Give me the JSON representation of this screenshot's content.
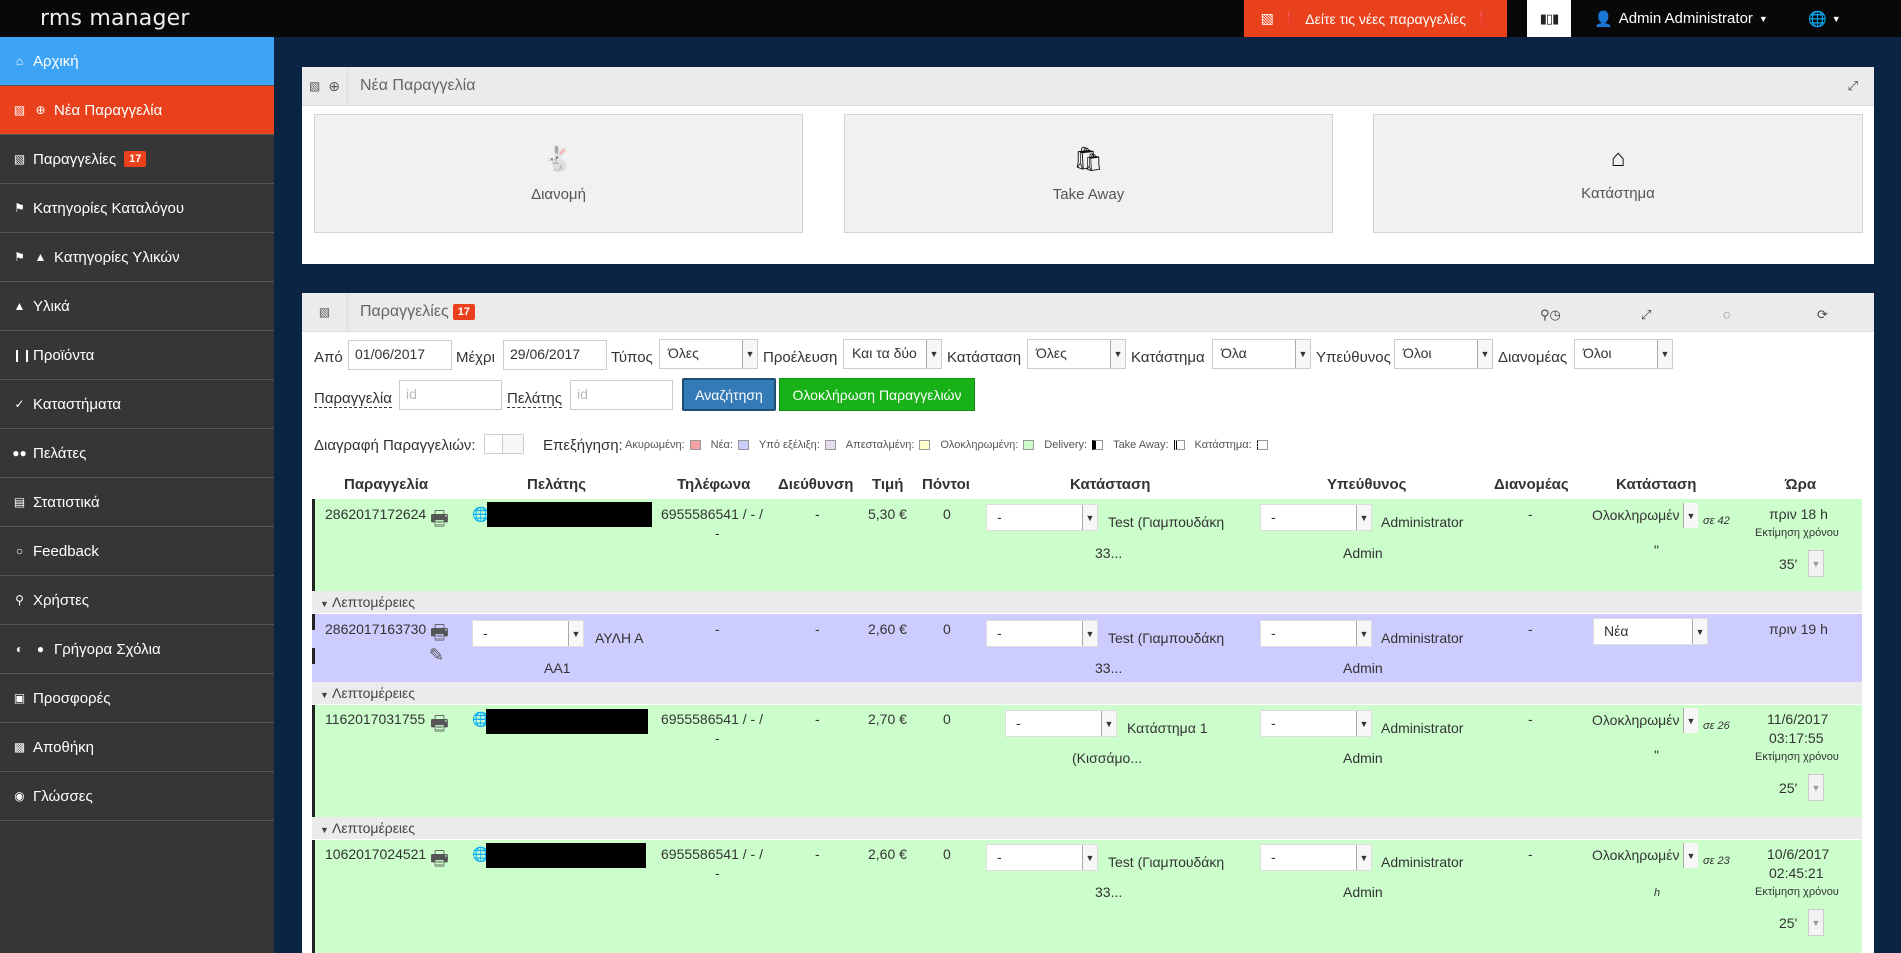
{
  "app": {
    "brand": "rms manager",
    "new_orders_alert": "Δείτε τις νέες παραγγελίες",
    "user": "Admin Administrator"
  },
  "sidebar": {
    "items": [
      {
        "label": "Αρχική",
        "icon": "home-icon"
      },
      {
        "label": "Νέα Παραγγελία",
        "icon": "inbox-plus-icon"
      },
      {
        "label": "Παραγγελίες",
        "icon": "inbox-icon",
        "badge": "17"
      },
      {
        "label": "Κατηγορίες Καταλόγου",
        "icon": "tags-icon"
      },
      {
        "label": "Κατηγορίες Υλικών",
        "icon": "tags-flask-icon"
      },
      {
        "label": "Υλικά",
        "icon": "flask-icon"
      },
      {
        "label": "Προϊόντα",
        "icon": "cutlery-icon"
      },
      {
        "label": "Καταστήματα",
        "icon": "cart-icon"
      },
      {
        "label": "Πελάτες",
        "icon": "users-icon"
      },
      {
        "label": "Στατιστικά",
        "icon": "bar-chart-icon"
      },
      {
        "label": "Feedback",
        "icon": "comment-icon"
      },
      {
        "label": "Χρήστες",
        "icon": "key-icon"
      },
      {
        "label": "Γρήγορα Σχόλια",
        "icon": "dashboard-comment-icon"
      },
      {
        "label": "Προσφορές",
        "icon": "gift-icon"
      },
      {
        "label": "Αποθήκη",
        "icon": "truck-icon"
      },
      {
        "label": "Γλώσσες",
        "icon": "globe-icon"
      }
    ]
  },
  "new_order_panel": {
    "title": "Νέα Παραγγελία",
    "types": [
      {
        "label": "Διανομή",
        "icon": "rabbit-icon"
      },
      {
        "label": "Take Away",
        "icon": "shopping-bag-icon"
      },
      {
        "label": "Κατάστημα",
        "icon": "home-icon"
      }
    ]
  },
  "orders_panel": {
    "title": "Παραγγελίες",
    "badge": "17",
    "filters": {
      "from_label": "Από",
      "from_value": "01/06/2017",
      "to_label": "Μέχρι",
      "to_value": "29/06/2017",
      "type_label": "Τύπος",
      "type_value": "Όλες",
      "origin_label": "Προέλευση",
      "origin_value": "Και τα δύο",
      "status_label": "Κατάσταση",
      "status_value": "Όλες",
      "store_label": "Κατάστημα",
      "store_value": "Όλα",
      "responsible_label": "Υπεύθυνος",
      "responsible_value": "Όλοι",
      "courier_label": "Διανομέας",
      "courier_value": "Όλοι",
      "order_label": "Παραγγελία",
      "order_placeholder": "id",
      "customer_label": "Πελάτης",
      "customer_placeholder": "id",
      "search_button": "Αναζήτηση",
      "complete_button": "Ολοκλήρωση Παραγγελιών"
    },
    "delete_label": "Διαγραφή Παραγγελιών:",
    "legend": {
      "title": "Επεξήγηση:",
      "items": [
        {
          "label": "Ακυρωμένη:",
          "color": "#f2a0a0"
        },
        {
          "label": "Νέα:",
          "color": "#ccccfe"
        },
        {
          "label": "Υπό εξέλιξη:",
          "color": "#e4dcec"
        },
        {
          "label": "Απεσταλμένη:",
          "color": "#fefecc"
        },
        {
          "label": "Ολοκληρωμένη:",
          "color": "#ccfecc"
        },
        {
          "label": "Delivery:",
          "color": "#000000"
        },
        {
          "label": "Take Away:",
          "color": "#444444"
        },
        {
          "label": "Κατάστημα:",
          "color": "#ffffff"
        }
      ]
    },
    "columns": [
      "Παραγγελία",
      "Πελάτης",
      "Τηλέφωνα",
      "Διεύθυνση",
      "Τιμή",
      "Πόντοι",
      "Κατάσταση",
      "Υπεύθυνος",
      "Διανομέας",
      "Κατάσταση",
      "Ώρα"
    ],
    "details_label": "Λεπτομέρειες",
    "rows": [
      {
        "id": "2862017172624",
        "phones": "6955586541 / - /",
        "phones2": "-",
        "address": "-",
        "price": "5,30 €",
        "points": "0",
        "store_sel": "-",
        "store": "Test (Γιαμπουδάκη",
        "store2": "33...",
        "resp_sel": "-",
        "responsible": "Administrator",
        "responsible2": "Admin",
        "courier": "-",
        "status": "Ολοκληρωμέν",
        "status_note": "σε 42",
        "status_sub": "\"",
        "time": "πριν 18 h",
        "eta_label": "Εκτίμηση χρόνου",
        "eta": "35'"
      },
      {
        "id": "2862017163730",
        "customer_sel": "-",
        "customer": "ΑΥΛΗ Α",
        "customer2": "ΑΑ1",
        "phones": "-",
        "address": "-",
        "price": "2,60 €",
        "points": "0",
        "store_sel": "-",
        "store": "Test (Γιαμπουδάκη",
        "store2": "33...",
        "resp_sel": "-",
        "responsible": "Administrator",
        "responsible2": "Admin",
        "courier": "-",
        "status": "Νέα",
        "time": "πριν 19 h"
      },
      {
        "id": "1162017031755",
        "phones": "6955586541 / - /",
        "phones2": "-",
        "address": "-",
        "price": "2,70 €",
        "points": "0",
        "store_sel": "-",
        "store": "Κατάστημα 1",
        "store2": "(Κισσάμο...",
        "resp_sel": "-",
        "responsible": "Administrator",
        "responsible2": "Admin",
        "courier": "-",
        "status": "Ολοκληρωμέν",
        "status_note": "σε 26",
        "status_sub": "\"",
        "time": "11/6/2017",
        "time2": "03:17:55",
        "eta_label": "Εκτίμηση χρόνου",
        "eta": "25'"
      },
      {
        "id": "1062017024521",
        "phones": "6955586541 / - /",
        "phones2": "-",
        "address": "-",
        "price": "2,60 €",
        "points": "0",
        "store_sel": "-",
        "store": "Test (Γιαμπουδάκη",
        "store2": "33...",
        "resp_sel": "-",
        "responsible": "Administrator",
        "responsible2": "Admin",
        "courier": "-",
        "status": "Ολοκληρωμέν",
        "status_note": "σε 23",
        "status_sub": "h",
        "time": "10/6/2017",
        "time2": "02:45:21",
        "eta_label": "Εκτίμηση χρόνου",
        "eta": "25'"
      }
    ]
  }
}
